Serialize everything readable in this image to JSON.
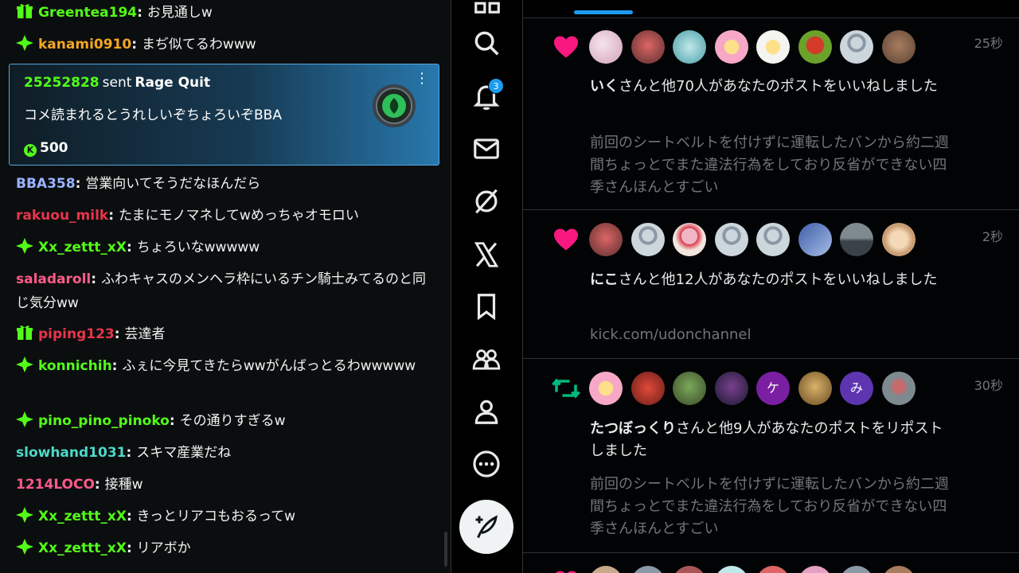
{
  "chat": {
    "messages": [
      {
        "badge": "gift-badge-icon",
        "user": "Greentea194",
        "user_color": "#53fc18",
        "text": "お見通しw"
      },
      {
        "badge": "diamond-badge-icon",
        "user": "kanami0910",
        "user_color": "#f5a623",
        "text": "まぢ似てるわwww"
      },
      {
        "badge": "",
        "user": "BBA358",
        "user_color": "#9ab3ff",
        "text": "営業向いてそうだなほんだら"
      },
      {
        "badge": "",
        "user": "rakuou_milk",
        "user_color": "#e8354a",
        "text": "たまにモノマネしてwめっちゃオモロい"
      },
      {
        "badge": "diamond-badge-icon",
        "user": "Xx_zettt_xX",
        "user_color": "#53fc18",
        "text": "ちょろいなwwwww"
      },
      {
        "badge": "",
        "user": "saladaroll",
        "user_color": "#ff5a8a",
        "text": "ふわキャスのメンヘラ枠にいるチン騎士みてるのと同じ気分ww"
      },
      {
        "badge": "gift-badge-icon",
        "user": "piping123",
        "user_color": "#e8354a",
        "text": "芸達者"
      },
      {
        "badge": "diamond-badge-icon",
        "user": "konnichih",
        "user_color": "#53fc18",
        "text": "ふぇに今見てきたらwwがんばっとるわwwwww"
      },
      {
        "badge": "diamond-badge-icon",
        "user": "pino_pino_pinoko",
        "user_color": "#53fc18",
        "text": "その通りすぎるw"
      },
      {
        "badge": "",
        "user": "slowhand1031",
        "user_color": "#4dd9c7",
        "text": "スキマ産業だね"
      },
      {
        "badge": "",
        "user": "1214LOCO",
        "user_color": "#ff5a8a",
        "text": "接種w"
      },
      {
        "badge": "diamond-badge-icon",
        "user": "Xx_zettt_xX",
        "user_color": "#53fc18",
        "text": "きっとリアコもおるってw"
      },
      {
        "badge": "diamond-badge-icon",
        "user": "Xx_zettt_xX",
        "user_color": "#53fc18",
        "text": "リアボか"
      }
    ],
    "gift": {
      "user": "25252828",
      "sent": "sent",
      "item": "Rage Quit",
      "message": "コメ読まれるとうれしいぞちょろいぞBBA",
      "coin_icon": "K",
      "amount": "500",
      "menu_icon": "kebab-menu-icon"
    }
  },
  "nav": {
    "items": [
      "grid-icon",
      "search-icon",
      "bell-icon",
      "mail-icon",
      "grok-icon",
      "x-logo-icon",
      "bookmark-icon",
      "communities-icon",
      "profile-icon",
      "more-icon"
    ],
    "notif_count": "3",
    "compose_icon": "compose-post-icon"
  },
  "feed": {
    "notifications": [
      {
        "type": "like",
        "time": "25秒",
        "name": "いく",
        "text": "さんと他70人があなたのポストをいいねしました",
        "quote": "前回のシートベルトを付けずに運転したバンから約二週間ちょっとでまた違法行為をしており反省ができない四季さんほんとすごい",
        "avatar_letters": [
          "",
          "",
          "",
          "",
          "",
          "",
          "",
          ""
        ]
      },
      {
        "type": "like",
        "time": "2秒",
        "name": "にこ",
        "text": "さんと他12人があなたのポストをいいねしました",
        "quote": "kick.com/udonchannel",
        "avatar_letters": [
          "",
          "",
          "",
          "",
          "",
          "",
          "",
          ""
        ]
      },
      {
        "type": "repost",
        "time": "30秒",
        "name": "たつぼっくり",
        "text": "さんと他9人があなたのポストをリポストしました",
        "quote": "前回のシートベルトを付けずに運転したバンから約二週間ちょっとでまた違法行為をしており反省ができない四季さんほんとすごい",
        "avatar_letters": [
          "",
          "",
          "",
          "",
          "ケ",
          "",
          "み",
          ""
        ]
      }
    ],
    "colors": {
      "like": "#f91880",
      "repost": "#00ba7c",
      "accent": "#1d9bf0"
    }
  }
}
